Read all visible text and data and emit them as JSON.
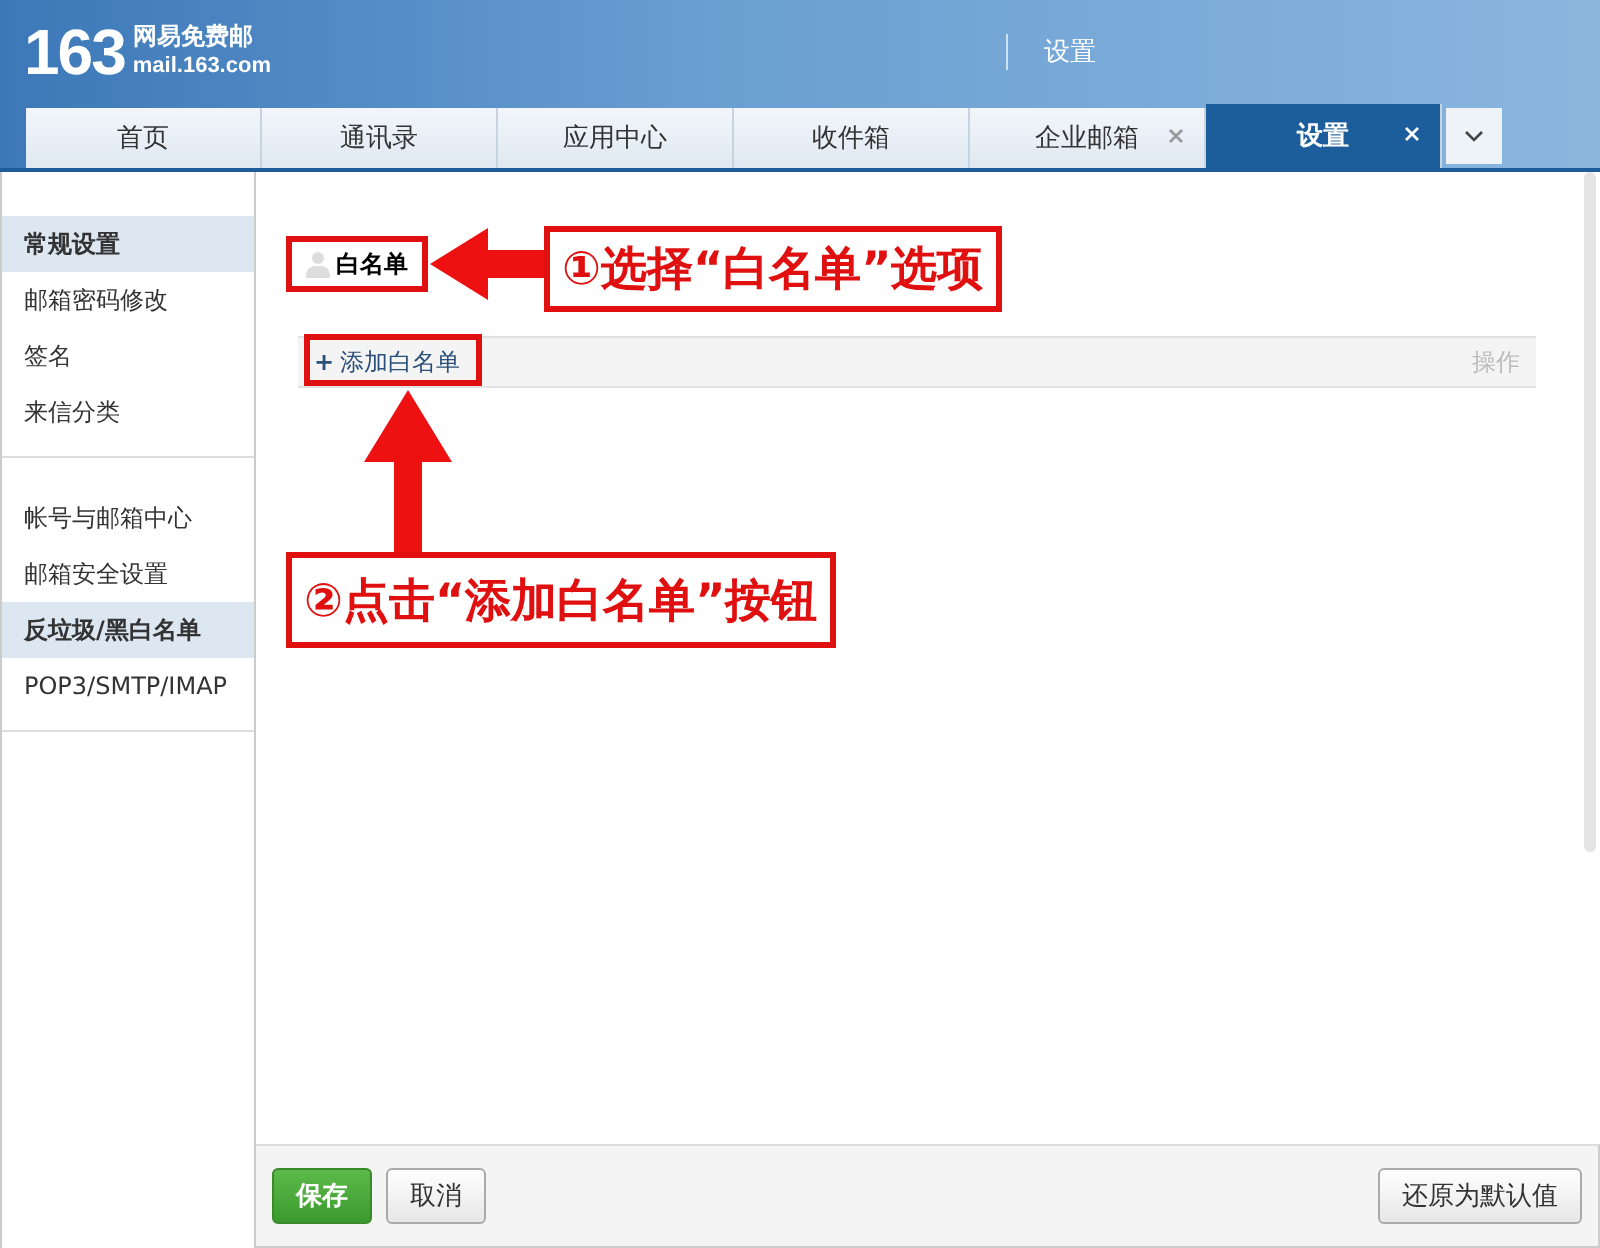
{
  "header": {
    "logo": "163",
    "brand": "网易免费邮",
    "domain": "mail.163.com",
    "title": "设置"
  },
  "tabs": [
    {
      "label": "首页",
      "selected": false,
      "closable": false
    },
    {
      "label": "通讯录",
      "selected": false,
      "closable": false
    },
    {
      "label": "应用中心",
      "selected": false,
      "closable": false
    },
    {
      "label": "收件箱",
      "selected": false,
      "closable": false
    },
    {
      "label": "企业邮箱",
      "selected": false,
      "closable": true
    },
    {
      "label": "设置",
      "selected": true,
      "closable": true
    }
  ],
  "sidebar": {
    "groups": [
      {
        "items": [
          {
            "label": "常规设置",
            "selected": true
          },
          {
            "label": "邮箱密码修改",
            "selected": false
          },
          {
            "label": "签名",
            "selected": false
          },
          {
            "label": "来信分类",
            "selected": false
          }
        ]
      },
      {
        "items": [
          {
            "label": "帐号与邮箱中心",
            "selected": false
          },
          {
            "label": "邮箱安全设置",
            "selected": false
          },
          {
            "label": "反垃圾/黑白名单",
            "selected": true
          },
          {
            "label": "POP3/SMTP/IMAP",
            "selected": false
          }
        ]
      }
    ]
  },
  "content": {
    "subtab": "白名单",
    "table": {
      "add_icon": "+",
      "add_label": "添加白名单",
      "columns": [
        "操作"
      ]
    }
  },
  "footer": {
    "buttons": [
      {
        "label": "保存",
        "kind": "primary"
      },
      {
        "label": "取消",
        "kind": "default"
      },
      {
        "label": "还原为默认值",
        "kind": "default"
      }
    ]
  },
  "annotations": [
    {
      "text": "①选择“白名单”选项"
    },
    {
      "text": "②点击“添加白名单”按钮"
    }
  ]
}
